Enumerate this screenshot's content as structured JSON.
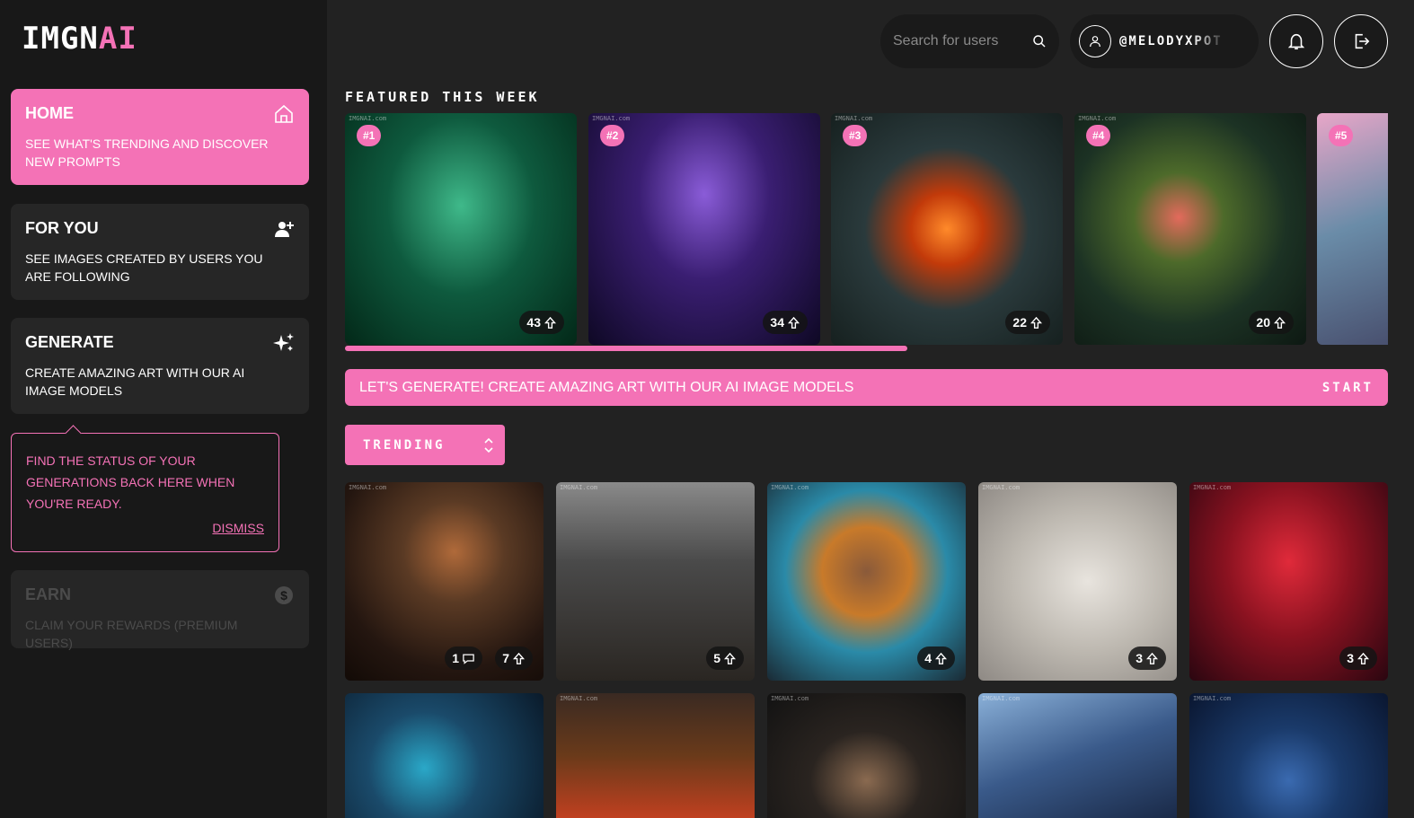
{
  "brand": {
    "logo_part1": "IMGN",
    "logo_part2": "AI",
    "accent": "#f472b6"
  },
  "sidebar": {
    "items": [
      {
        "title": "HOME",
        "desc": "SEE WHAT'S TRENDING AND DISCOVER NEW PROMPTS",
        "icon": "home-icon"
      },
      {
        "title": "FOR YOU",
        "desc": "SEE IMAGES CREATED BY USERS YOU ARE FOLLOWING",
        "icon": "user-plus-icon"
      },
      {
        "title": "GENERATE",
        "desc": "CREATE AMAZING ART WITH OUR AI IMAGE MODELS",
        "icon": "sparkles-icon"
      },
      {
        "title": "EARN",
        "desc": "CLAIM YOUR REWARDS (PREMIUM USERS)",
        "icon": "dollar-icon"
      }
    ],
    "tip": {
      "text": "FIND THE STATUS OF YOUR GENERATIONS BACK HERE WHEN YOU'RE READY.",
      "dismiss": "DISMISS"
    }
  },
  "header": {
    "search_placeholder": "Search for users",
    "username": "@MELODYXPOT"
  },
  "featured": {
    "title": "FEATURED THIS WEEK",
    "items": [
      {
        "rank": "#1",
        "votes": "43"
      },
      {
        "rank": "#2",
        "votes": "34"
      },
      {
        "rank": "#3",
        "votes": "22"
      },
      {
        "rank": "#4",
        "votes": "20"
      },
      {
        "rank": "#5",
        "votes": ""
      }
    ]
  },
  "banner": {
    "text": "LET'S GENERATE! CREATE AMAZING ART WITH OUR AI IMAGE MODELS",
    "start": "START"
  },
  "sort": {
    "selected": "TRENDING"
  },
  "grid": {
    "row1": [
      {
        "comments": "1",
        "votes": "7"
      },
      {
        "votes": "5"
      },
      {
        "votes": "4"
      },
      {
        "votes": "3"
      },
      {
        "votes": "3"
      }
    ]
  },
  "watermark": "IMGNAI.com"
}
